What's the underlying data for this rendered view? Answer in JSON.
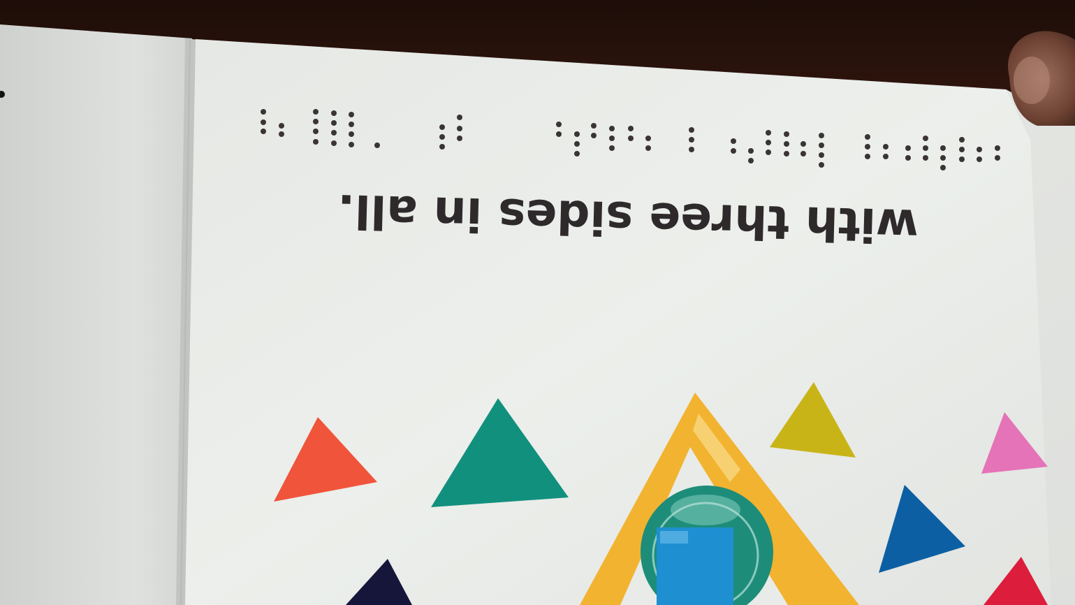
{
  "page": {
    "text": "with three sides in all."
  },
  "colors": {
    "paper": "#e9ebe8",
    "paper_left": "#dcdedb",
    "text": "#2e2a2c",
    "orange_triangle": "#f0543a",
    "teal_triangle": "#12907e",
    "yellow_frame": "#f2b330",
    "olive_triangle": "#c9b418",
    "pink_triangle": "#e573b8",
    "blue_triangle": "#0d5fa3",
    "red_triangle": "#dc1e3c",
    "navy_triangle": "#16153a",
    "circle_center": "#1d8d7a",
    "square_center": "#1e8fd0"
  }
}
